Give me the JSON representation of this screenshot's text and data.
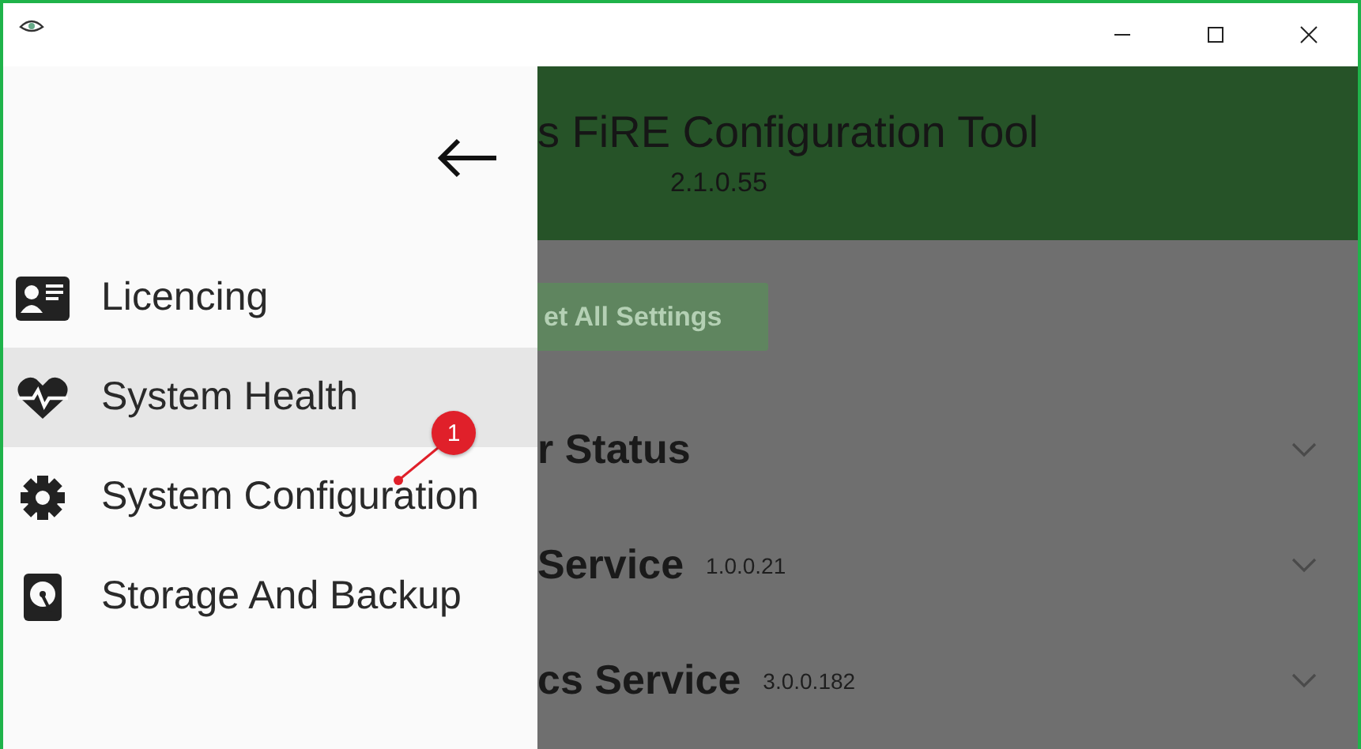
{
  "drawer": {
    "items": [
      {
        "label": "Licencing",
        "selected": false
      },
      {
        "label": "System Health",
        "selected": true
      },
      {
        "label": "System Configuration",
        "selected": false
      },
      {
        "label": "Storage And Backup",
        "selected": false
      }
    ]
  },
  "app_header": {
    "title": "s FiRE Configuration Tool",
    "version": "2.1.0.55"
  },
  "reset_button": {
    "label": "et All Settings"
  },
  "sections": [
    {
      "title": "r Status",
      "expanded": false
    },
    {
      "title": "Service",
      "version": "1.0.0.21",
      "expanded": false
    },
    {
      "title": "cs Service",
      "version": "3.0.0.182",
      "expanded": false
    }
  ],
  "annotation": {
    "label": "1"
  }
}
